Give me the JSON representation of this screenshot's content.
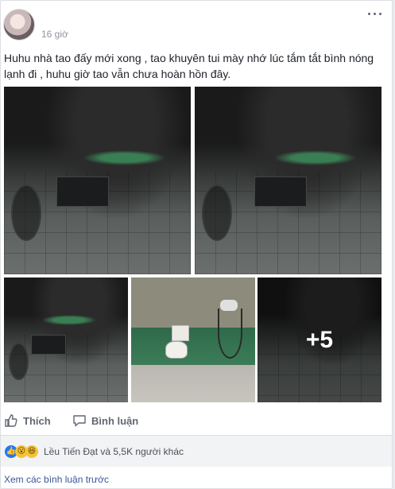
{
  "post": {
    "time": "16 giờ",
    "text": "Huhu nhà tao đấy mới xong , tao khuyên tui mày nhớ lúc tắm tắt bình nóng lạnh đi , huhu giờ tao vẫn chưa hoàn hồn đây.",
    "more_photos_label": "+5"
  },
  "actions": {
    "like_label": "Thích",
    "comment_label": "Bình luận"
  },
  "reactions": {
    "icons": [
      "like-icon",
      "wow-icon",
      "haha-icon"
    ],
    "summary": "Lều Tiến Đạt và 5,5K người khác"
  },
  "comments": {
    "view_previous": "Xem các bình luận trước"
  },
  "colors": {
    "link": "#385898",
    "like_blue": "#2078f4",
    "muted": "#90949c"
  }
}
